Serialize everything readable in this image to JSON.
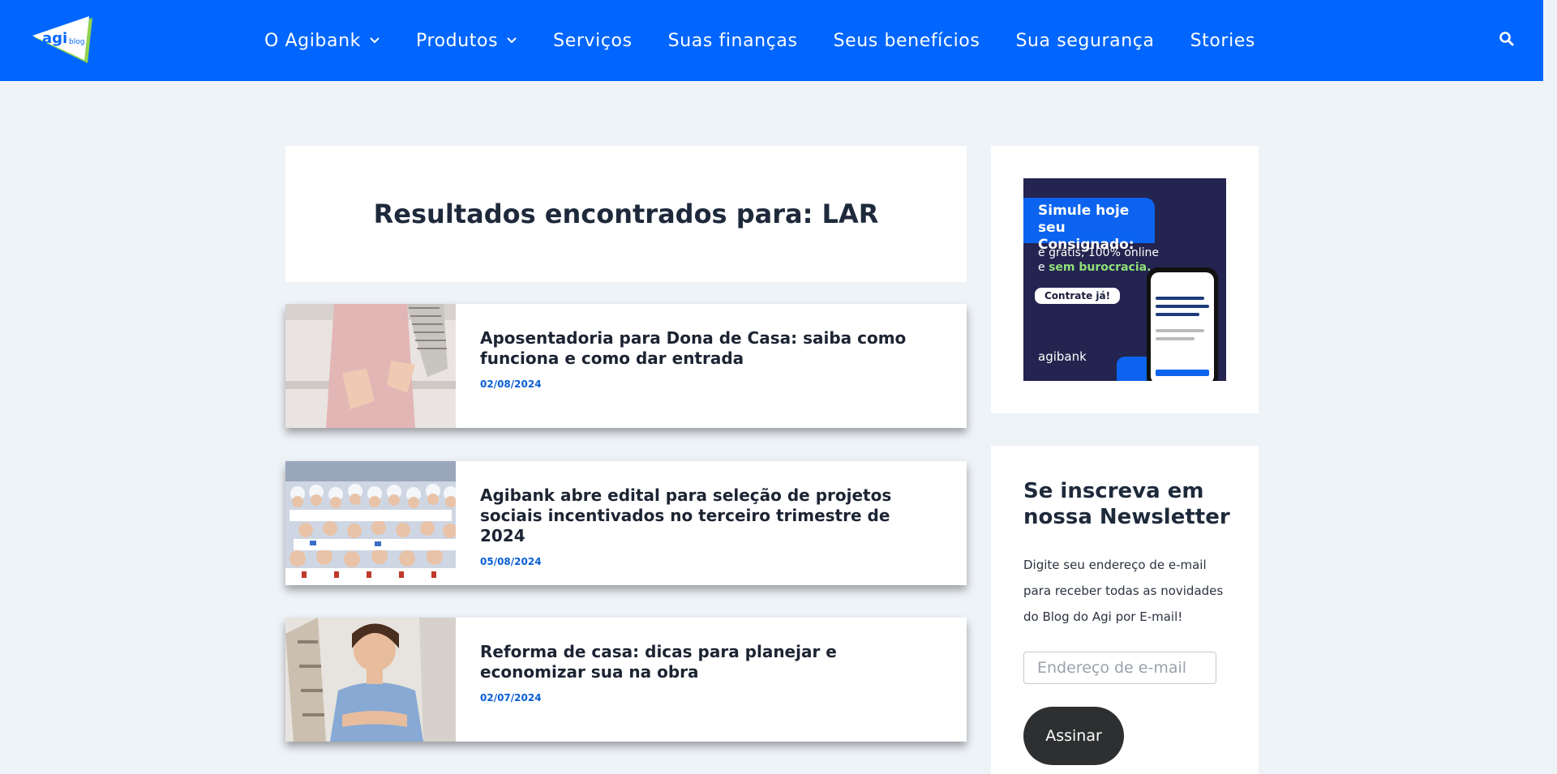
{
  "brand": {
    "logo_text": "agi",
    "logo_suffix": "blog"
  },
  "nav": {
    "items": [
      {
        "label": "O Agibank",
        "has_dropdown": true
      },
      {
        "label": "Produtos",
        "has_dropdown": true
      },
      {
        "label": "Serviços",
        "has_dropdown": false
      },
      {
        "label": "Suas finanças",
        "has_dropdown": false
      },
      {
        "label": "Seus benefícios",
        "has_dropdown": false
      },
      {
        "label": "Sua segurança",
        "has_dropdown": false
      },
      {
        "label": "Stories",
        "has_dropdown": false
      }
    ],
    "search_icon": "search-icon"
  },
  "results": {
    "title": "Resultados encontrados para: LAR"
  },
  "posts": [
    {
      "title": "Aposentadoria para Dona de Casa: saiba como funciona e como dar entrada",
      "date": "02/08/2024"
    },
    {
      "title": "Agibank abre edital para seleção de projetos sociais incentivados no terceiro trimestre de 2024",
      "date": "05/08/2024"
    },
    {
      "title": "Reforma de casa: dicas para planejar e economizar sua na obra",
      "date": "02/07/2024"
    }
  ],
  "ad": {
    "headline": "Simule hoje seu Consignado:",
    "line1": "é grátis, 100% online",
    "line2_prefix": "e ",
    "line2_highlight": "sem burocracia.",
    "cta": "Contrate já!",
    "brand": "agibank"
  },
  "newsletter": {
    "title": "Se inscreva em nossa Newsletter",
    "description": "Digite seu endereço de e-mail para receber todas as novidades do Blog do Agi por E-mail!",
    "email_placeholder": "Endereço de e-mail",
    "button_label": "Assinar"
  },
  "colors": {
    "header": "#0066ff",
    "page_bg": "#eef3f8",
    "date": "#0a5fd6",
    "button": "#2d2f31"
  }
}
